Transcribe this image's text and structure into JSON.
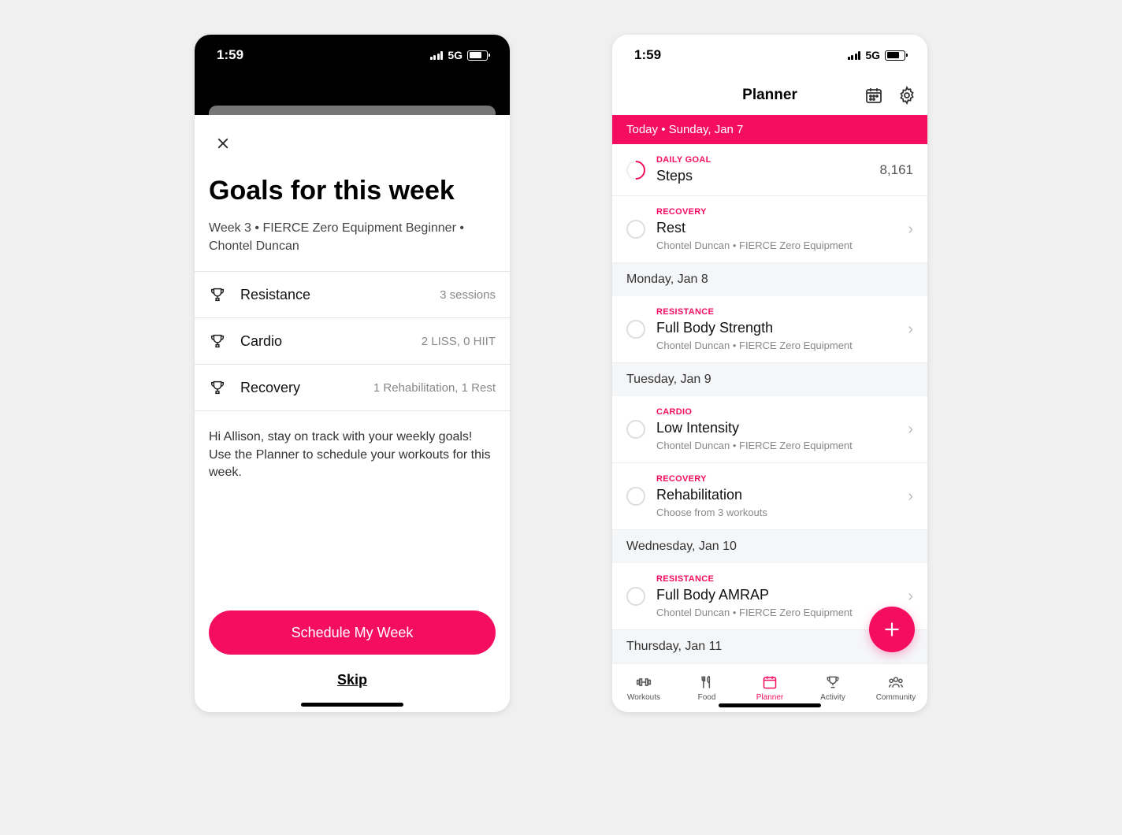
{
  "status": {
    "time": "1:59",
    "network": "5G"
  },
  "modal": {
    "title": "Goals for this week",
    "subtitle": "Week 3 • FIERCE Zero Equipment Beginner • Chontel Duncan",
    "goals": [
      {
        "label": "Resistance",
        "value": "3 sessions"
      },
      {
        "label": "Cardio",
        "value": "2 LISS, 0 HIIT"
      },
      {
        "label": "Recovery",
        "value": "1 Rehabilitation, 1 Rest"
      }
    ],
    "message": "Hi Allison, stay on track with your weekly goals! Use the Planner to schedule your workouts for this week.",
    "primary_button": "Schedule My Week",
    "skip_button": "Skip"
  },
  "planner": {
    "header_title": "Planner",
    "today_bar": "Today • Sunday, Jan 7",
    "steps": {
      "tag": "DAILY GOAL",
      "title": "Steps",
      "value": "8,161"
    },
    "days": [
      {
        "header": null,
        "items": [
          {
            "tag": "RECOVERY",
            "title": "Rest",
            "sub": "Chontel Duncan • FIERCE Zero Equipment"
          }
        ]
      },
      {
        "header": "Monday, Jan 8",
        "items": [
          {
            "tag": "RESISTANCE",
            "title": "Full Body Strength",
            "sub": "Chontel Duncan • FIERCE Zero Equipment"
          }
        ]
      },
      {
        "header": "Tuesday, Jan 9",
        "items": [
          {
            "tag": "CARDIO",
            "title": "Low Intensity",
            "sub": "Chontel Duncan • FIERCE Zero Equipment"
          },
          {
            "tag": "RECOVERY",
            "title": "Rehabilitation",
            "sub": "Choose from 3 workouts"
          }
        ]
      },
      {
        "header": "Wednesday, Jan 10",
        "items": [
          {
            "tag": "RESISTANCE",
            "title": "Full Body AMRAP",
            "sub": "Chontel Duncan • FIERCE Zero Equipment"
          }
        ]
      },
      {
        "header": "Thursday, Jan 11",
        "items": []
      }
    ],
    "tabs": [
      {
        "label": "Workouts"
      },
      {
        "label": "Food"
      },
      {
        "label": "Planner"
      },
      {
        "label": "Activity"
      },
      {
        "label": "Community"
      }
    ]
  }
}
